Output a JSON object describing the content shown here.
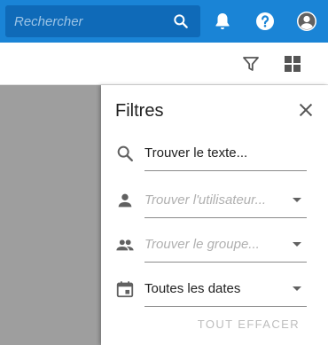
{
  "header": {
    "search_placeholder": "Rechercher",
    "icons": [
      "search-icon",
      "bell-icon",
      "help-icon",
      "account-icon"
    ]
  },
  "toolbar": {
    "icons": [
      "filter-icon",
      "grid-view-icon"
    ]
  },
  "filters": {
    "title": "Filtres",
    "text_field": {
      "value": "Trouver le texte...",
      "icon": "search-icon"
    },
    "user_field": {
      "placeholder": "Trouver l'utilisateur...",
      "icon": "person-icon"
    },
    "group_field": {
      "placeholder": "Trouver le groupe...",
      "icon": "group-icon"
    },
    "date_field": {
      "value": "Toutes les dates",
      "icon": "calendar-icon"
    },
    "clear_all_label": "TOUT EFFACER"
  },
  "colors": {
    "appbar": "#1a84d6",
    "search_box": "#0f6ab8",
    "backdrop": "#9e9e9e",
    "panel": "#ffffff"
  }
}
